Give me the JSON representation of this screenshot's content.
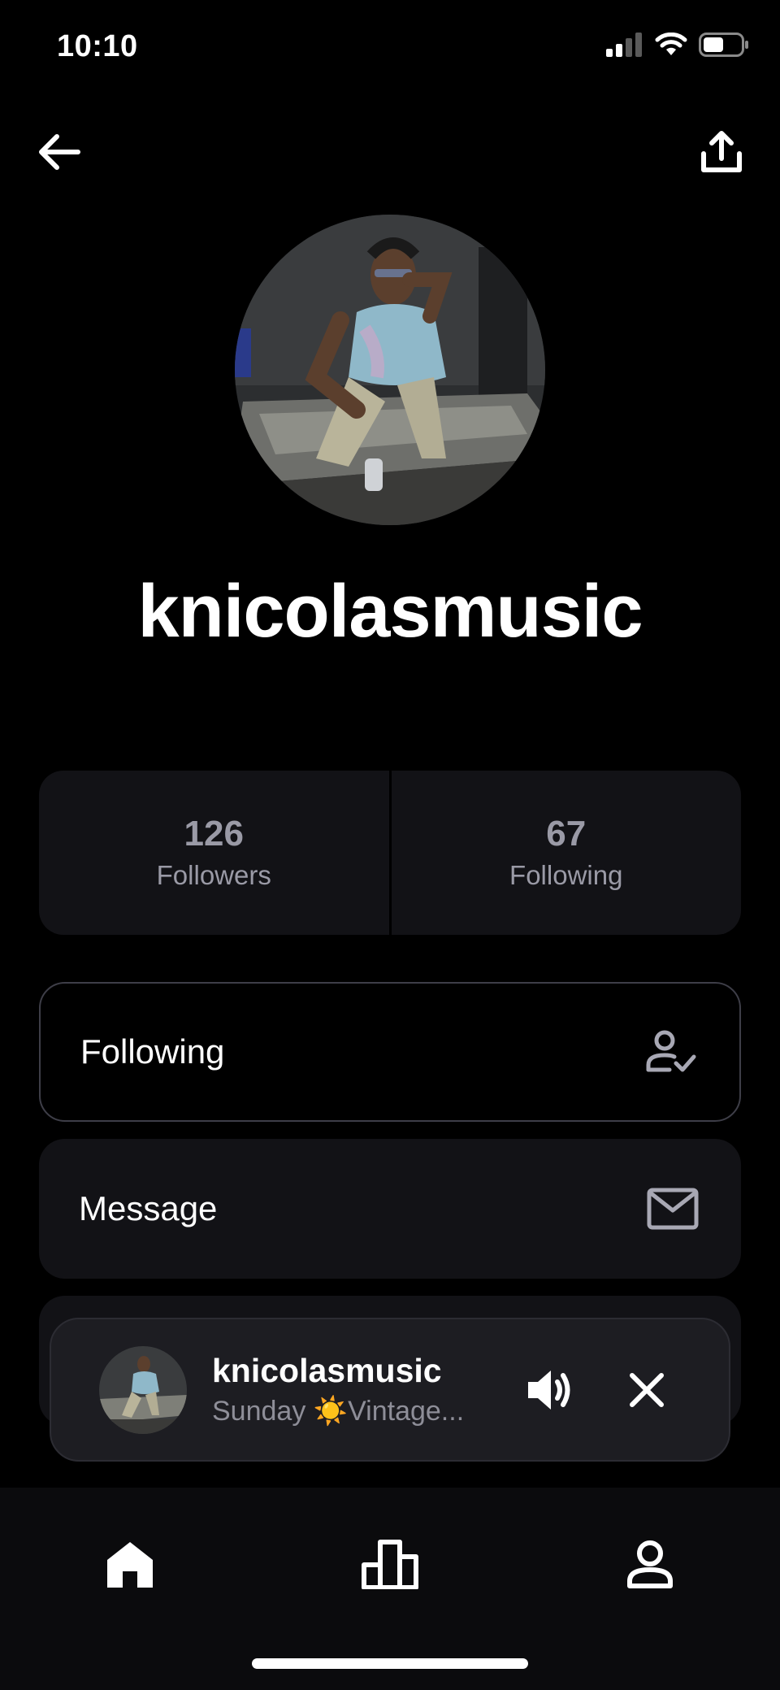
{
  "status": {
    "time": "10:10",
    "icons": [
      "cellular-signal-icon",
      "wifi-icon",
      "battery-icon"
    ]
  },
  "nav": {
    "back_icon": "arrow-left-icon",
    "share_icon": "share-upload-icon"
  },
  "profile": {
    "username": "knicolasmusic"
  },
  "stats": {
    "followers_count": "126",
    "followers_label": "Followers",
    "following_count": "67",
    "following_label": "Following"
  },
  "actions": {
    "following_label": "Following",
    "following_icon": "user-check-icon",
    "message_label": "Message",
    "message_icon": "mail-icon"
  },
  "player": {
    "title": "knicolasmusic",
    "subtitle": "Sunday ☀️Vintage...",
    "volume_icon": "volume-icon",
    "close_icon": "close-icon"
  },
  "tabs": [
    {
      "name": "home",
      "icon": "home-icon"
    },
    {
      "name": "charts",
      "icon": "bar-chart-icon"
    },
    {
      "name": "profile",
      "icon": "user-icon"
    }
  ],
  "colors": {
    "background": "#000000",
    "card": "#121216",
    "muted_text": "#9a9aa6",
    "player_bg": "#1d1d22"
  }
}
